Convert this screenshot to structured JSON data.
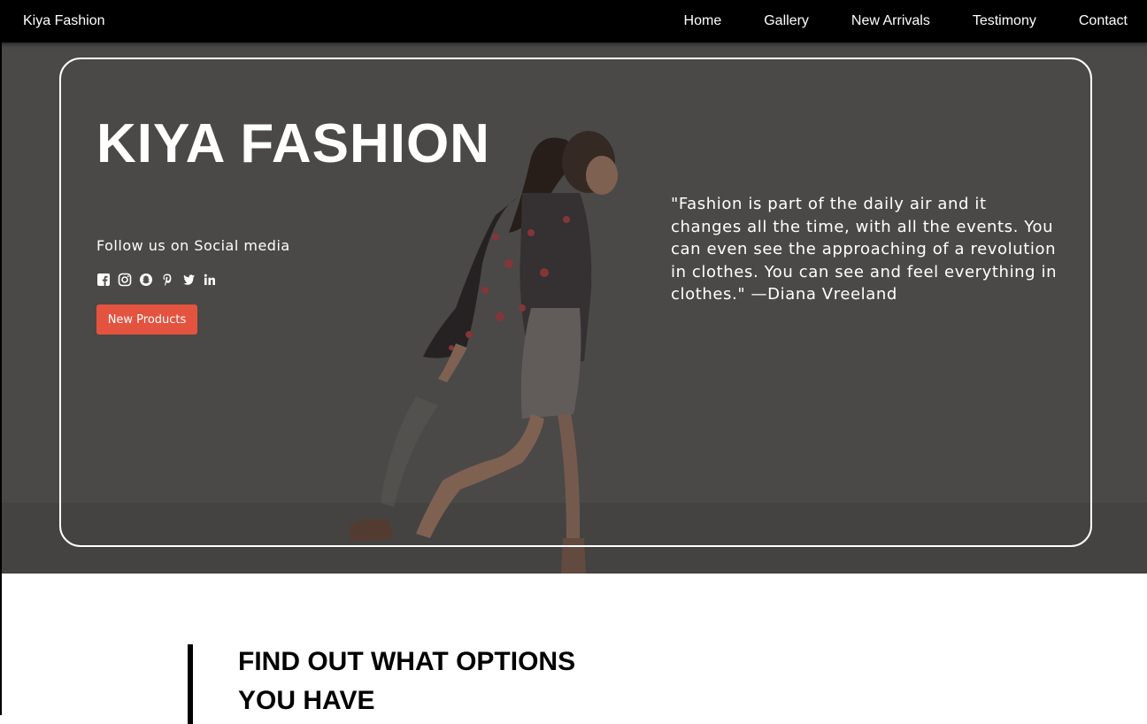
{
  "nav": {
    "brand": "Kiya Fashion",
    "links": [
      "Home",
      "Gallery",
      "New Arrivals",
      "Testimony",
      "Contact"
    ]
  },
  "hero": {
    "title": "KIYA FASHION",
    "follow_text": "Follow us on Social media",
    "social_icons": [
      "facebook-icon",
      "instagram-icon",
      "snapchat-icon",
      "pinterest-icon",
      "twitter-icon",
      "linkedin-icon"
    ],
    "cta_label": "New Products",
    "quote": "\"Fashion is part of the daily air and it changes all the time, with all the events. You can even see the approaching of a revolution in clothes. You can see and feel everything in clothes.\" —Diana Vreeland"
  },
  "options": {
    "heading": "FIND OUT WHAT OPTIONS YOU HAVE"
  },
  "colors": {
    "nav_bg": "#000000",
    "hero_overlay": "#4f4e4c",
    "cta": "#e4533f",
    "text_light": "#ffffff"
  }
}
